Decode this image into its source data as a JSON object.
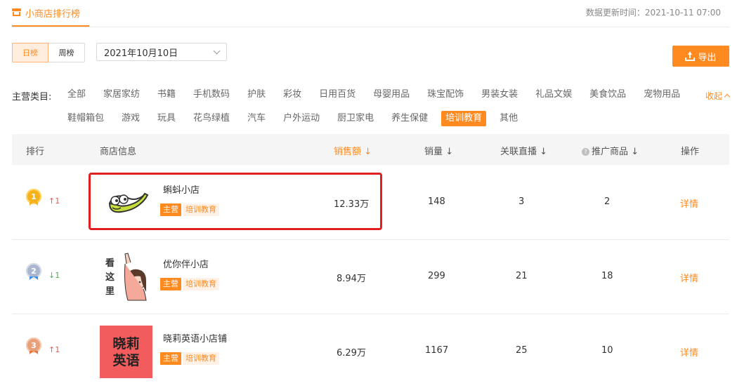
{
  "header": {
    "title": "小商店排行榜",
    "update_time": "数据更新时间：2021-10-11 07:00"
  },
  "toolbar": {
    "tabs": [
      "日榜",
      "周榜"
    ],
    "active_tab": "日榜",
    "date_value": "2021年10月10日",
    "export_label": "导出"
  },
  "categories": {
    "label": "主营类目:",
    "items": [
      "全部",
      "家居家纺",
      "书籍",
      "手机数码",
      "护肤",
      "彩妆",
      "日用百货",
      "母婴用品",
      "珠宝配饰",
      "男装女装",
      "礼品文娱",
      "美食饮品",
      "宠物用品",
      "鞋帽箱包",
      "游戏",
      "玩具",
      "花鸟绿植",
      "汽车",
      "户外运动",
      "厨卫家电",
      "养生保健",
      "培训教育",
      "其他"
    ],
    "active": "培训教育",
    "collapse_label": "收起"
  },
  "table": {
    "headers": {
      "rank": "排行",
      "shop_info": "商店信息",
      "sales_amount": "销售额",
      "sales_volume": "销量",
      "related_live": "关联直播",
      "promoted_goods": "推广商品",
      "action": "操作"
    },
    "rows": [
      {
        "rank": "1",
        "trend": "↑1",
        "trend_dir": "up",
        "name": "蝌蚪小店",
        "main_tag": "主营",
        "category": "培训教育",
        "sales_amount": "12.33万",
        "sales_volume": "148",
        "related_live": "3",
        "promoted_goods": "2",
        "action": "详情"
      },
      {
        "rank": "2",
        "trend": "↓1",
        "trend_dir": "down",
        "name": "优你伴小店",
        "main_tag": "主营",
        "category": "培训教育",
        "sales_amount": "8.94万",
        "sales_volume": "299",
        "related_live": "21",
        "promoted_goods": "18",
        "action": "详情",
        "thumb_text": "看这里"
      },
      {
        "rank": "3",
        "trend": "↑1",
        "trend_dir": "up",
        "name": "晓莉英语小店铺",
        "main_tag": "主营",
        "category": "培训教育",
        "sales_amount": "6.29万",
        "sales_volume": "1167",
        "related_live": "25",
        "promoted_goods": "10",
        "action": "详情",
        "thumb_text": "晓莉英语"
      }
    ]
  },
  "colors": {
    "accent": "#ff8a1f",
    "highlight": "#e02020",
    "gold": "#f5b21c",
    "silver": "#aab6cf",
    "bronze": "#e8a07a"
  }
}
